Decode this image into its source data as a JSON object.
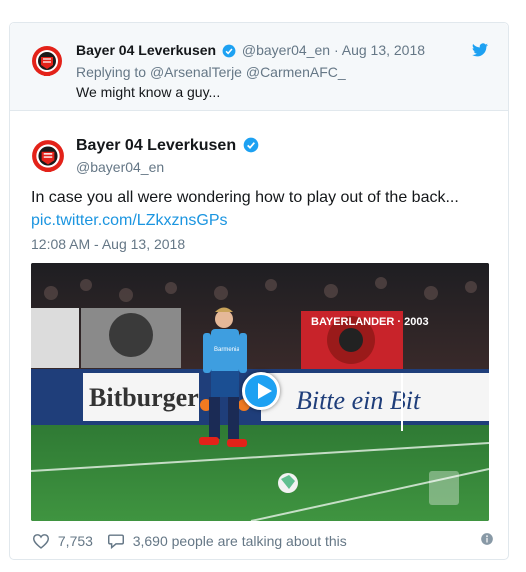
{
  "parent_tweet": {
    "author_name": "Bayer 04 Leverkusen",
    "author_handle": "@bayer04_en",
    "separator": "·",
    "date": "Aug 13, 2018",
    "replying_label": "Replying to",
    "reply_to": "@ArsenalTerje @CarmenAFC_",
    "text": "We might know a guy..."
  },
  "main_tweet": {
    "author_name": "Bayer 04 Leverkusen",
    "author_handle": "@bayer04_en",
    "text": "In case you all were wondering how to play out of the back...",
    "link": "pic.twitter.com/LZkxznsGPs",
    "timestamp": "12:08 AM - Aug 13, 2018"
  },
  "media": {
    "banner_left": "Bitburger",
    "banner_right": "Bitte ein Bit",
    "jersey_text": "Barmenia",
    "flag_text": "BAYERLANDER · 2003"
  },
  "footer": {
    "likes": "7,753",
    "talking": "3,690 people are talking about this"
  },
  "colors": {
    "twitter_blue": "#1da1f2",
    "link_blue": "#1b95e0",
    "secondary_text": "#657786",
    "bayer_red": "#e32219"
  }
}
